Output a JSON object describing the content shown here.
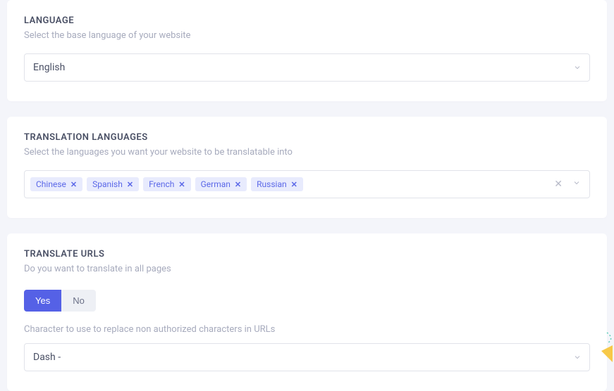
{
  "language": {
    "title": "LANGUAGE",
    "desc": "Select the base language of your website",
    "value": "English"
  },
  "translation": {
    "title": "TRANSLATION LANGUAGES",
    "desc": "Select the languages you want your website to be translatable into",
    "tags": [
      "Chinese",
      "Spanish",
      "French",
      "German",
      "Russian"
    ]
  },
  "urls": {
    "title": "TRANSLATE URLS",
    "desc": "Do you want to translate in all pages",
    "yes": "Yes",
    "no": "No",
    "active": "yes",
    "char_desc": "Character to use to replace non authorized characters in URLs",
    "char_value": "Dash -"
  }
}
